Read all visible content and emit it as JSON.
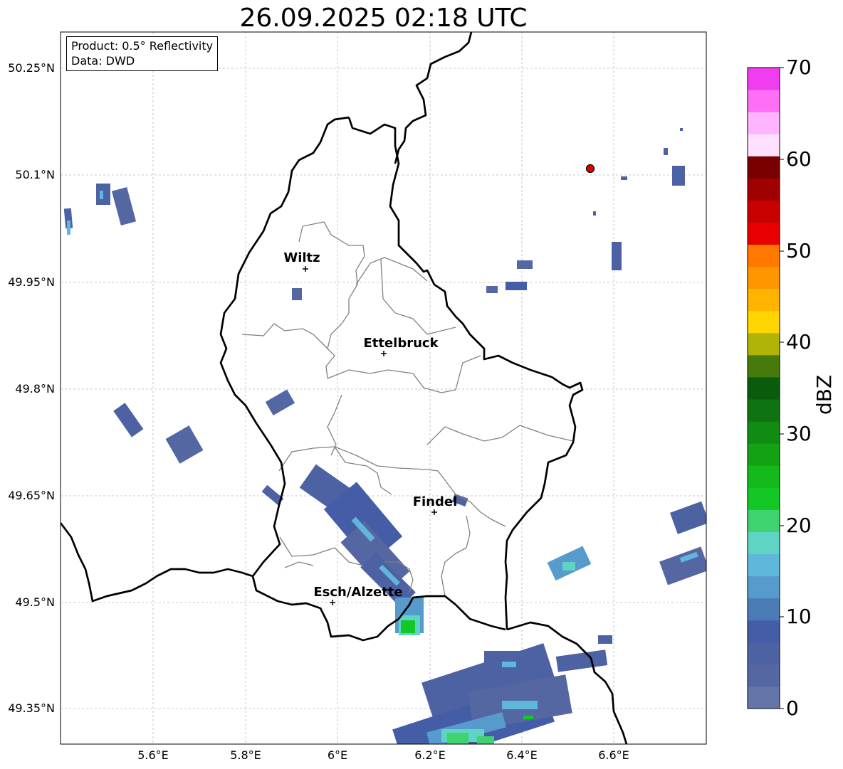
{
  "title": "26.09.2025 02:18 UTC",
  "info": {
    "product": "Product: 0.5° Reflectivity",
    "data": "Data: DWD"
  },
  "axes": {
    "lat_ticks": [
      "50.25°N",
      "50.1°N",
      "49.95°N",
      "49.8°N",
      "49.65°N",
      "49.5°N",
      "49.35°N"
    ],
    "lon_ticks": [
      "5.6°E",
      "5.8°E",
      "6°E",
      "6.2°E",
      "6.4°E",
      "6.6°E"
    ]
  },
  "cities": [
    {
      "name": "Wiltz",
      "lon": 5.935,
      "lat": 49.97
    },
    {
      "name": "Ettelbruck",
      "lon": 6.102,
      "lat": 49.849
    },
    {
      "name": "Findel",
      "lon": 6.212,
      "lat": 49.626
    },
    {
      "name": "Esch/Alzette",
      "lon": 5.99,
      "lat": 49.497
    }
  ],
  "radar_site": {
    "lon": 6.548,
    "lat": 50.11
  },
  "colorbar": {
    "label": "dBZ",
    "ticks": [
      "0",
      "10",
      "20",
      "30",
      "40",
      "50",
      "60",
      "70"
    ],
    "colors": [
      "#6475aa",
      "#5567a3",
      "#4d62a2",
      "#445da6",
      "#4a7bb5",
      "#569bcc",
      "#60b7dc",
      "#60d4c4",
      "#3ed36f",
      "#13c826",
      "#14b91b",
      "#12a214",
      "#108c12",
      "#0e7310",
      "#0b5b0d",
      "#467a0c",
      "#afb406",
      "#ffd600",
      "#ffb500",
      "#ff9600",
      "#ff7800",
      "#e60000",
      "#c80000",
      "#a00000",
      "#780000",
      "#ffe1ff",
      "#ffb4ff",
      "#ff6ef6",
      "#ef3def"
    ]
  }
}
